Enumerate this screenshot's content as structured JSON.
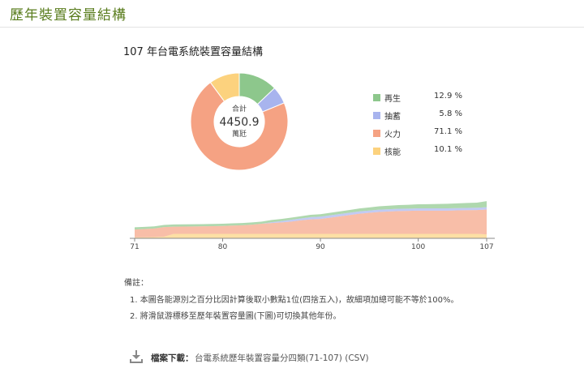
{
  "page": {
    "title": "歷年裝置容量結構",
    "notes_title": "備註：",
    "notes": [
      "1. 本圖各能源別之百分比因計算後取小數點1位(四捨五入)，故細項加總可能不等於100%。",
      "2. 將滑鼠游標移至歷年裝置容量圖(下圖)可切換其他年份。"
    ],
    "download_label": "檔案下載：",
    "download_link": "台電系統歷年裝置容量分四類(71-107) (CSV)"
  },
  "colors": {
    "renewable": "#8dc78c",
    "pumped": "#a8b4ee",
    "thermal": "#f5a283",
    "nuclear": "#fcd27e",
    "title_green": "#5a7d1e"
  },
  "chart_data": [
    {
      "type": "pie",
      "title": "107 年台電系統裝置容量結構",
      "center_label": "合計",
      "center_value": "4450.9",
      "center_unit": "萬瓩",
      "slices": [
        {
          "name": "再生",
          "value": 12.9,
          "label": "12.9 %",
          "color": "#8dc78c"
        },
        {
          "name": "抽蓄",
          "value": 5.8,
          "label": "5.8 %",
          "color": "#a8b4ee"
        },
        {
          "name": "火力",
          "value": 71.1,
          "label": "71.1 %",
          "color": "#f5a283"
        },
        {
          "name": "核能",
          "value": 10.1,
          "label": "10.1 %",
          "color": "#fcd27e"
        }
      ]
    },
    {
      "type": "area",
      "stacked": true,
      "x": [
        71,
        72,
        73,
        74,
        75,
        76,
        77,
        78,
        79,
        80,
        81,
        82,
        83,
        84,
        85,
        86,
        87,
        88,
        89,
        90,
        91,
        92,
        93,
        94,
        95,
        96,
        97,
        98,
        99,
        100,
        101,
        102,
        103,
        104,
        105,
        106,
        107
      ],
      "xticks": [
        71,
        80,
        90,
        100,
        107
      ],
      "grid": false,
      "series": [
        {
          "name": "核能",
          "color": "#fcd27e",
          "values": [
            110,
            110,
            140,
            180,
            514,
            514,
            514,
            514,
            514,
            514,
            514,
            514,
            514,
            514,
            514,
            514,
            514,
            514,
            514,
            514,
            514,
            514,
            514,
            514,
            514,
            514,
            514,
            514,
            514,
            514,
            514,
            514,
            514,
            514,
            514,
            514,
            450
          ]
        },
        {
          "name": "火力",
          "color": "#f5a283",
          "values": [
            900,
            950,
            980,
            1100,
            820,
            830,
            840,
            860,
            880,
            900,
            950,
            980,
            1050,
            1150,
            1230,
            1300,
            1400,
            1550,
            1650,
            1700,
            1850,
            2000,
            2150,
            2300,
            2400,
            2500,
            2550,
            2600,
            2620,
            2650,
            2650,
            2650,
            2650,
            2680,
            2700,
            2720,
            2840
          ]
        },
        {
          "name": "抽蓄",
          "color": "#a8b4ee",
          "values": [
            0,
            0,
            0,
            0,
            0,
            0,
            0,
            0,
            0,
            0,
            0,
            0,
            0,
            0,
            100,
            150,
            200,
            200,
            250,
            260,
            260,
            260,
            260,
            260,
            260,
            260,
            260,
            260,
            260,
            260,
            260,
            260,
            260,
            260,
            260,
            260,
            260
          ]
        },
        {
          "name": "再生",
          "color": "#8dc78c",
          "values": [
            250,
            250,
            250,
            250,
            250,
            250,
            250,
            250,
            250,
            250,
            250,
            250,
            250,
            250,
            250,
            250,
            250,
            260,
            270,
            280,
            290,
            300,
            320,
            340,
            360,
            380,
            400,
            420,
            440,
            460,
            480,
            500,
            520,
            540,
            560,
            580,
            700
          ]
        }
      ],
      "ylim": [
        0,
        5000
      ]
    }
  ]
}
